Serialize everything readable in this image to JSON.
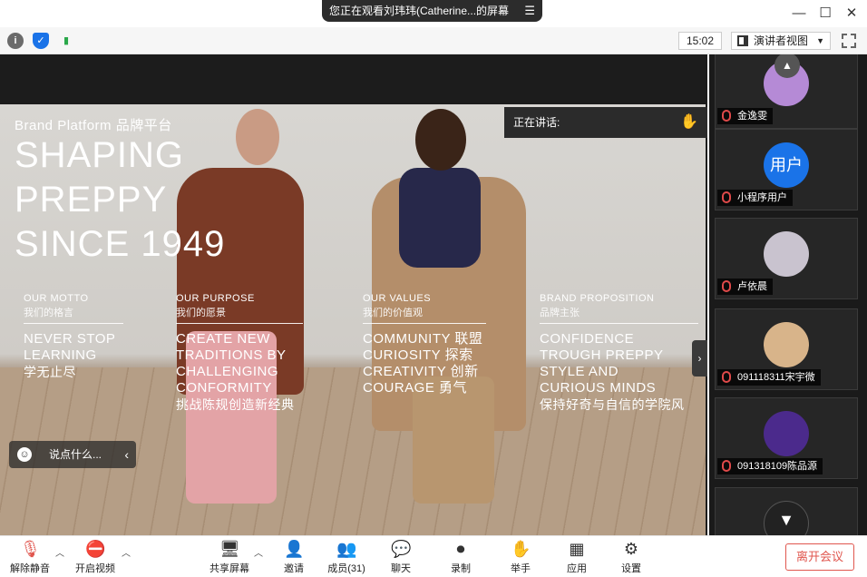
{
  "window": {
    "share_banner": "您正在观看刘玮玮(Catherine...的屏幕",
    "share_menu_icon": "menu-icon",
    "controls": [
      "minimize-icon",
      "maximize-icon",
      "close-icon"
    ]
  },
  "toolbar": {
    "clock": "15:02",
    "view_mode": "演讲者视图",
    "icons": [
      "info-icon",
      "shield-icon",
      "signal-icon",
      "grid-view-icon",
      "fullscreen-icon"
    ]
  },
  "speaking": {
    "label": "正在讲话:"
  },
  "slide": {
    "brand": "Brand Platform 品牌平台",
    "headline": [
      "SHAPING",
      "PREPPY",
      "SINCE 1949"
    ],
    "columns": [
      {
        "heading": "OUR MOTTO",
        "sub": "我们的格言",
        "body": [
          "NEVER STOP",
          "LEARNING"
        ],
        "zh": [
          "学无止尽"
        ]
      },
      {
        "heading": "OUR PURPOSE",
        "sub": "我们的愿景",
        "body": [
          "CREATE NEW",
          "TRADITIONS BY",
          "CHALLENGING",
          "CONFORMITY"
        ],
        "zh": [
          "挑战陈规创造新经典"
        ]
      },
      {
        "heading": "OUR VALUES",
        "sub": "我们的价值观",
        "body": [
          "COMMUNITY 联盟",
          "CURIOSITY 探索",
          "CREATIVITY 创新",
          "COURAGE 勇气"
        ],
        "zh": []
      },
      {
        "heading": "BRAND PROPOSITION",
        "sub": "品牌主张",
        "body": [
          "CONFIDENCE",
          "TROUGH PREPPY",
          "STYLE AND",
          "CURIOUS MINDS"
        ],
        "zh": [
          "保持好奇与自信的学院风"
        ]
      }
    ]
  },
  "chat": {
    "placeholder": "说点什么..."
  },
  "participants": [
    {
      "name": "金逸雯",
      "avatar_text": "",
      "avatar_color": "#b58ad6"
    },
    {
      "name": "小程序用户",
      "avatar_text": "用户",
      "avatar_color": "#1a73e8"
    },
    {
      "name": "卢依晨",
      "avatar_text": "",
      "avatar_color": "#c9c3cf"
    },
    {
      "name": "091118311宋宇微",
      "avatar_text": "",
      "avatar_color": "#d8b48a"
    },
    {
      "name": "091318109陈品源",
      "avatar_text": "",
      "avatar_color": "#4b2a8c"
    }
  ],
  "bottombar": {
    "unmute": "解除静音",
    "video": "开启视频",
    "share": "共享屏幕",
    "invite": "邀请",
    "members": "成员(31)",
    "chat": "聊天",
    "record": "录制",
    "raise_hand": "举手",
    "apps": "应用",
    "settings": "设置",
    "leave": "离开会议"
  },
  "colors": {
    "accent_red": "#e0564e",
    "panel_bg": "#1a1a1a",
    "user_blue": "#1a73e8"
  }
}
